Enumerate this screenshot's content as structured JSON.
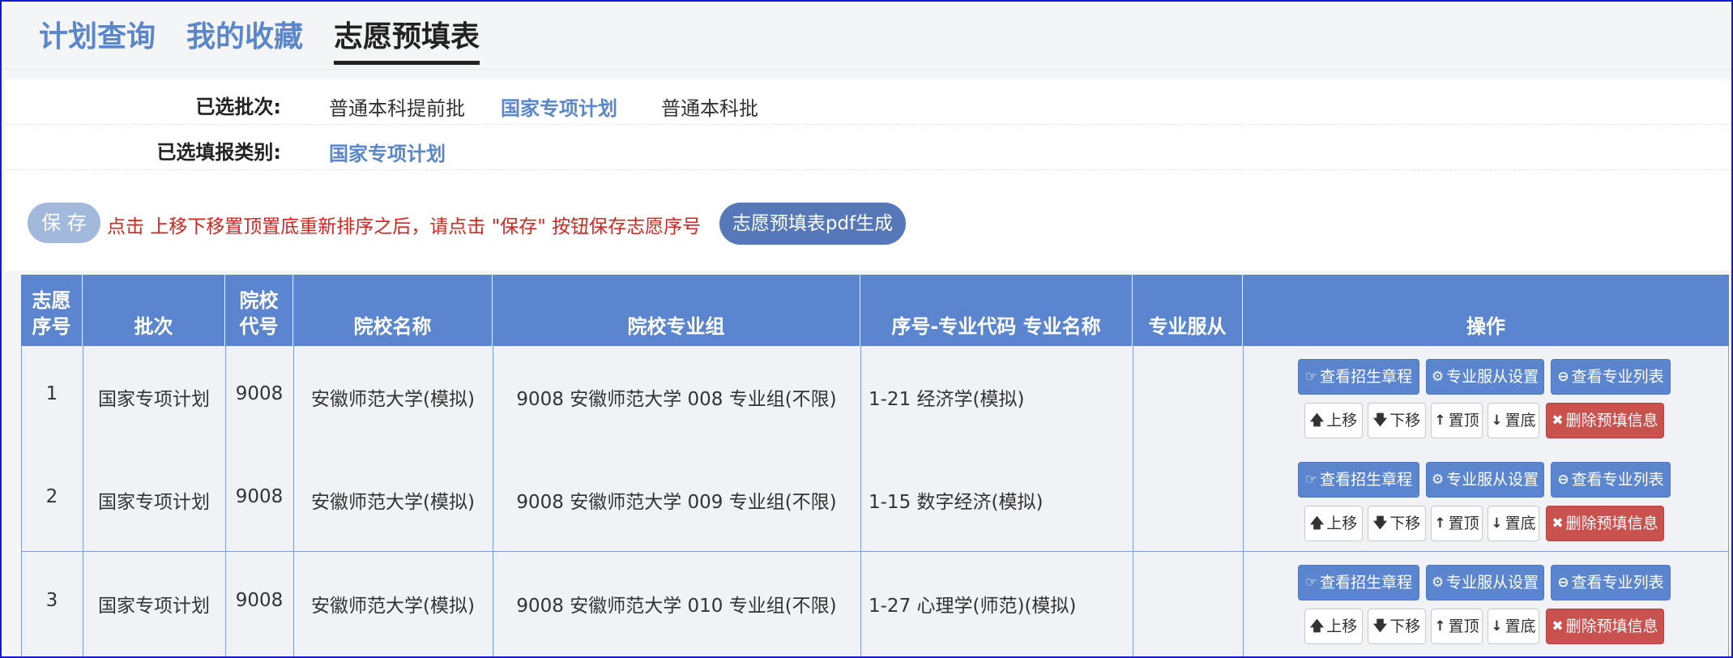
{
  "tabs": [
    {
      "label": "计划查询",
      "active": false
    },
    {
      "label": "我的收藏",
      "active": false
    },
    {
      "label": "志愿预填表",
      "active": true
    }
  ],
  "filters": {
    "batch_label": "已选批次:",
    "batch_options": [
      "普通本科提前批",
      "国家专项计划",
      "普通本科批"
    ],
    "batch_selected": "国家专项计划",
    "category_label": "已选填报类别:",
    "category_value": "国家专项计划"
  },
  "savebar": {
    "save_label": "保 存",
    "hint": "点击 上移下移置顶置底重新排序之后，请点击 \"保存\" 按钮保存志愿序号",
    "pdf_label": "志愿预填表pdf生成"
  },
  "table": {
    "headers": {
      "seq": [
        "志愿",
        "序号"
      ],
      "batch": "批次",
      "code": [
        "院校",
        "代号"
      ],
      "school": "院校名称",
      "group": "院校专业组",
      "major": "序号-专业代码 专业名称",
      "obey": "专业服从",
      "ops": "操作"
    },
    "rows": [
      {
        "seq": "1",
        "batch": "国家专项计划",
        "code": "9008",
        "school": "安徽师范大学(模拟)",
        "group": "9008 安徽师范大学 008 专业组(不限)",
        "major": "1-21 经济学(模拟)",
        "obey": ""
      },
      {
        "seq": "2",
        "batch": "国家专项计划",
        "code": "9008",
        "school": "安徽师范大学(模拟)",
        "group": "9008 安徽师范大学 009 专业组(不限)",
        "major": "1-15 数字经济(模拟)",
        "obey": ""
      },
      {
        "seq": "3",
        "batch": "国家专项计划",
        "code": "9008",
        "school": "安徽师范大学(模拟)",
        "group": "9008 安徽师范大学 010 专业组(不限)",
        "major": "1-27 心理学(师范)(模拟)",
        "obey": ""
      }
    ],
    "actions": {
      "view_rules": "查看招生章程",
      "obey_settings": "专业服从设置",
      "view_majors": "查看专业列表",
      "move_up": "上移",
      "move_down": "下移",
      "to_top": "置顶",
      "to_bottom": "置底",
      "delete": "删除预填信息"
    }
  },
  "colors": {
    "accent": "#5b86cf",
    "danger": "#c9524e",
    "hint_red": "#d4261f",
    "frame": "#1a1ad0"
  }
}
